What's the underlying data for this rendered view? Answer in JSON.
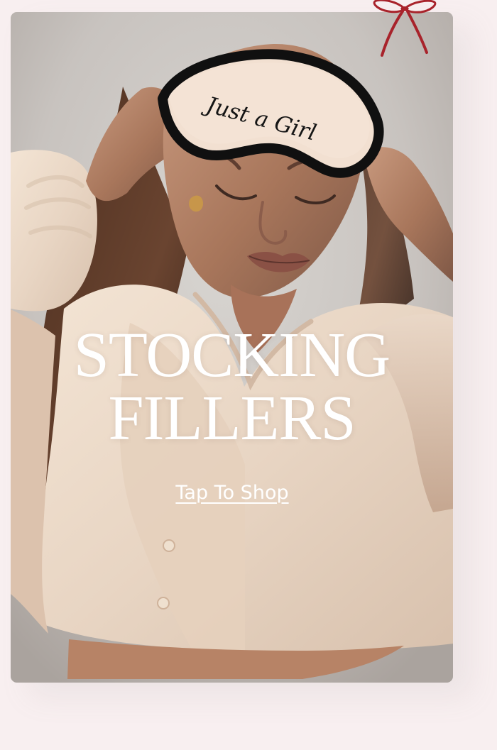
{
  "promo": {
    "headline_line1": "STOCKING",
    "headline_line2": "FILLERS",
    "cta_label": "Tap To Shop",
    "eye_mask_text": "Just a Girl"
  },
  "decorations": {
    "bow_icon": "bow-icon"
  },
  "colors": {
    "page_background": "#f8eff0",
    "bow": "#a8232b",
    "headline": "#ffffff"
  }
}
